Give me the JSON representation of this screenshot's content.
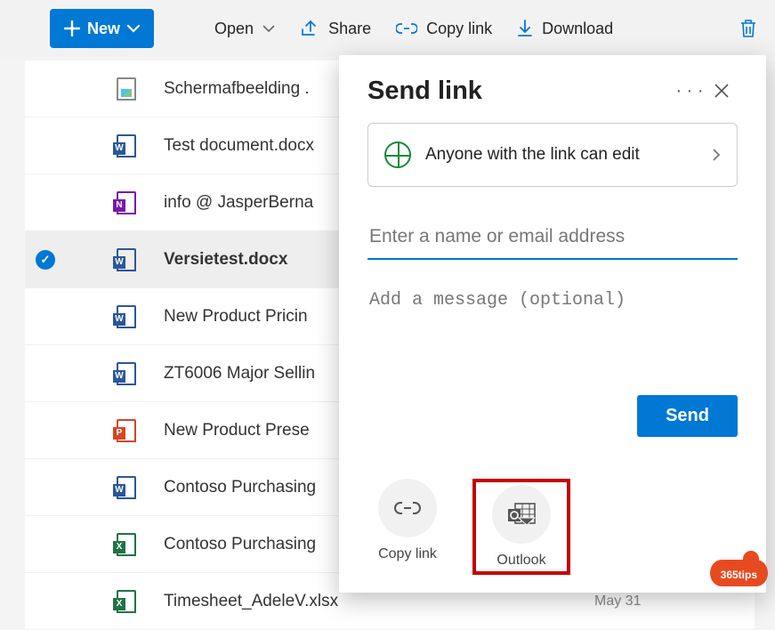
{
  "toolbar": {
    "new_label": "New",
    "open_label": "Open",
    "share_label": "Share",
    "copylink_label": "Copy link",
    "download_label": "Download"
  },
  "files": [
    {
      "name": "Schermafbeelding .",
      "type": "image",
      "selected": false,
      "date": ""
    },
    {
      "name": "Test document.docx",
      "type": "word",
      "selected": false,
      "date": ""
    },
    {
      "name": "info @ JasperBerna",
      "type": "onenote",
      "selected": false,
      "date": ""
    },
    {
      "name": "Versietest.docx",
      "type": "word",
      "selected": true,
      "date": ""
    },
    {
      "name": "New Product Pricin",
      "type": "word",
      "selected": false,
      "date": ""
    },
    {
      "name": "ZT6006 Major Sellin",
      "type": "word",
      "selected": false,
      "date": ""
    },
    {
      "name": "New Product Prese",
      "type": "powerpoint",
      "selected": false,
      "date": ""
    },
    {
      "name": "Contoso Purchasing",
      "type": "word",
      "selected": false,
      "date": ""
    },
    {
      "name": "Contoso Purchasing",
      "type": "excel",
      "selected": false,
      "date": ""
    },
    {
      "name": "Timesheet_AdeleV.xlsx",
      "type": "excel",
      "selected": false,
      "date": "May 31"
    }
  ],
  "share_panel": {
    "title": "Send link",
    "permission_label": "Anyone with the link can edit",
    "recipients_placeholder": "Enter a name or email address",
    "message_placeholder": "Add a message (optional)",
    "send_label": "Send",
    "targets": {
      "copylink_label": "Copy link",
      "outlook_label": "Outlook"
    }
  },
  "brand": {
    "label": "365tips"
  },
  "colors": {
    "primary": "#0078d4",
    "success": "#168a3a",
    "highlight": "#c40000",
    "brand": "#e74a21"
  }
}
